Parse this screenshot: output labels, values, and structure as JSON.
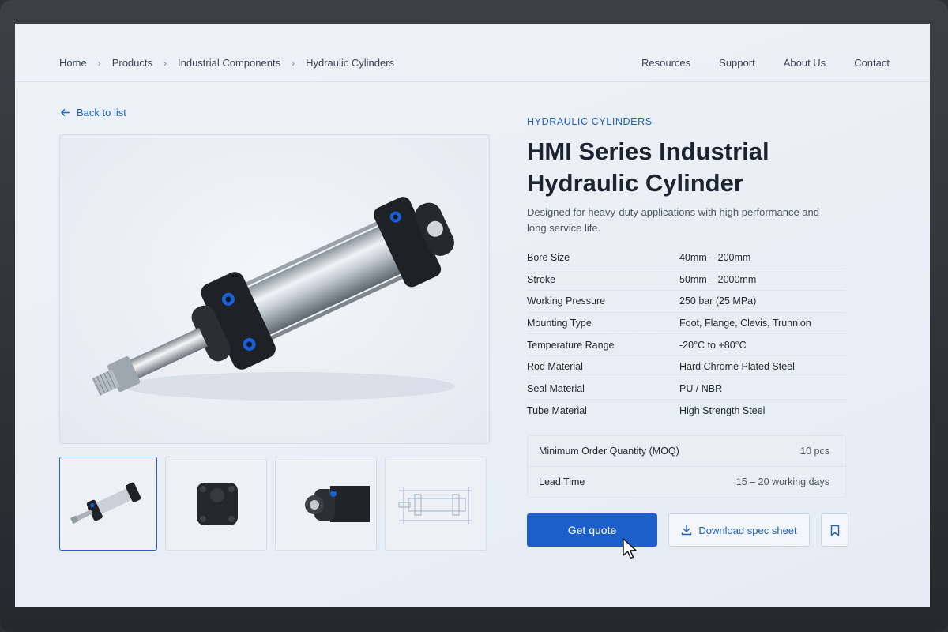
{
  "breadcrumb": [
    "Home",
    "Products",
    "Industrial Components",
    "Hydraulic Cylinders"
  ],
  "nav": [
    "Resources",
    "Support",
    "About Us",
    "Contact"
  ],
  "back_label": "Back to list",
  "product": {
    "category": "HYDRAULIC CYLINDERS",
    "title": "HMI Series Industrial Hydraulic Cylinder",
    "description": "Designed for heavy-duty applications with high performance and long service life.",
    "specs": [
      {
        "label": "Bore Size",
        "value": "40mm – 200mm"
      },
      {
        "label": "Stroke",
        "value": "50mm – 2000mm"
      },
      {
        "label": "Working Pressure",
        "value": "250 bar (25 MPa)"
      },
      {
        "label": "Mounting Type",
        "value": "Foot, Flange, Clevis, Trunnion"
      },
      {
        "label": "Temperature Range",
        "value": "-20°C to +80°C"
      },
      {
        "label": "Rod Material",
        "value": "Hard Chrome Plated Steel"
      },
      {
        "label": "Seal Material",
        "value": "PU / NBR"
      },
      {
        "label": "Tube Material",
        "value": "High Strength Steel"
      }
    ],
    "order": {
      "moq_label": "Minimum Order Quantity (MOQ)",
      "moq_value": "10 pcs",
      "lead_label": "Lead Time",
      "lead_value": "15 – 20 working days"
    }
  },
  "actions": {
    "quote_label": "Get quote",
    "download_label": "Download spec sheet"
  },
  "icons": {
    "back": "arrow-left-icon",
    "breadcrumb_separator": "chevron-right-icon",
    "download": "download-icon",
    "bookmark": "bookmark-icon",
    "cursor": "mouse-pointer-icon"
  },
  "colors": {
    "accent": "#1c5fcb",
    "link": "#1f5fc4",
    "background": "#e9eef5",
    "text": "#1b2430"
  }
}
